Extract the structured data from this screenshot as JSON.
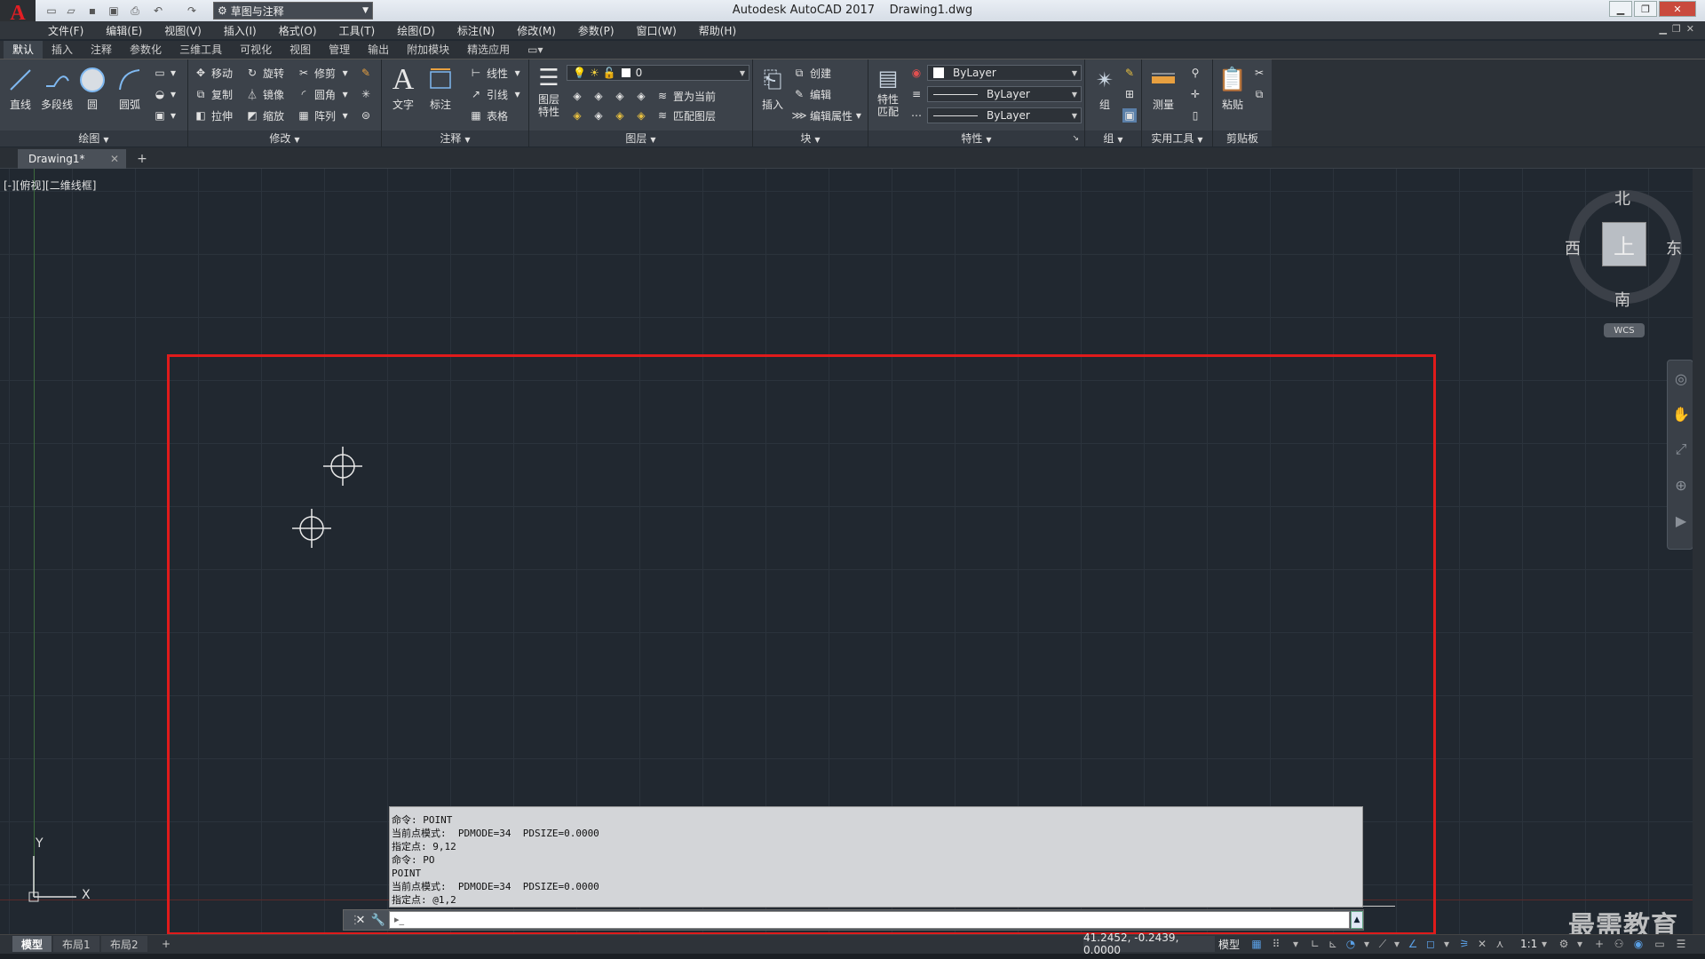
{
  "app": {
    "title": "Autodesk AutoCAD 2017",
    "file": "Drawing1.dwg",
    "logo": "A",
    "workspace": "草图与注释"
  },
  "menu": [
    "文件(F)",
    "编辑(E)",
    "视图(V)",
    "插入(I)",
    "格式(O)",
    "工具(T)",
    "绘图(D)",
    "标注(N)",
    "修改(M)",
    "参数(P)",
    "窗口(W)",
    "帮助(H)"
  ],
  "ribbon_tabs": [
    "默认",
    "插入",
    "注释",
    "参数化",
    "三维工具",
    "可视化",
    "视图",
    "管理",
    "输出",
    "附加模块",
    "精选应用"
  ],
  "panels": {
    "draw": {
      "title": "绘图",
      "line": "直线",
      "polyline": "多段线",
      "circle": "圆",
      "arc": "圆弧"
    },
    "modify": {
      "title": "修改",
      "move": "移动",
      "rotate": "旋转",
      "trim": "修剪",
      "copy": "复制",
      "mirror": "镜像",
      "fillet": "圆角",
      "stretch": "拉伸",
      "scale": "缩放",
      "array": "阵列"
    },
    "annotation": {
      "title": "注释",
      "text": "文字",
      "dimension": "标注",
      "linear": "线性",
      "leader": "引线",
      "table": "表格"
    },
    "layers": {
      "title": "图层",
      "layer_props": "图层\n特性",
      "current_layer": "0",
      "set_current": "置为当前",
      "match_layer": "匹配图层"
    },
    "block": {
      "title": "块",
      "insert": "插入",
      "create": "创建",
      "edit": "编辑",
      "edit_attr": "编辑属性"
    },
    "properties": {
      "title": "特性",
      "match": "特性\n匹配",
      "color": "ByLayer",
      "linetype": "ByLayer",
      "lineweight": "ByLayer"
    },
    "groups": {
      "title": "组",
      "group": "组"
    },
    "utilities": {
      "title": "实用工具",
      "measure": "测量"
    },
    "clipboard": {
      "title": "剪贴板",
      "paste": "粘贴"
    }
  },
  "file_tab": "Drawing1*",
  "viewport_label": "[-][俯视][二维线框]",
  "viewcube": {
    "north": "北",
    "south": "南",
    "east": "东",
    "west": "西",
    "face": "上",
    "wcs": "WCS"
  },
  "ucs": {
    "x": "X",
    "y": "Y"
  },
  "command_history": [
    "命令: POINT",
    "当前点模式:  PDMODE=34  PDSIZE=0.0000",
    "指定点: 9,12",
    "命令: PO",
    "POINT",
    "当前点模式:  PDMODE=34  PDSIZE=0.0000",
    "指定点: @1,2"
  ],
  "command_prompt": "▸_",
  "layout_tabs": [
    "模型",
    "布局1",
    "布局2"
  ],
  "status": {
    "coords": "41.2452, -0.2439, 0.0000",
    "model": "模型",
    "scale": "1:1"
  },
  "watermark": "最需教育",
  "colors": {
    "highlight": "#e01b1b",
    "canvas": "#212830",
    "accent": "#5aa0e6"
  }
}
